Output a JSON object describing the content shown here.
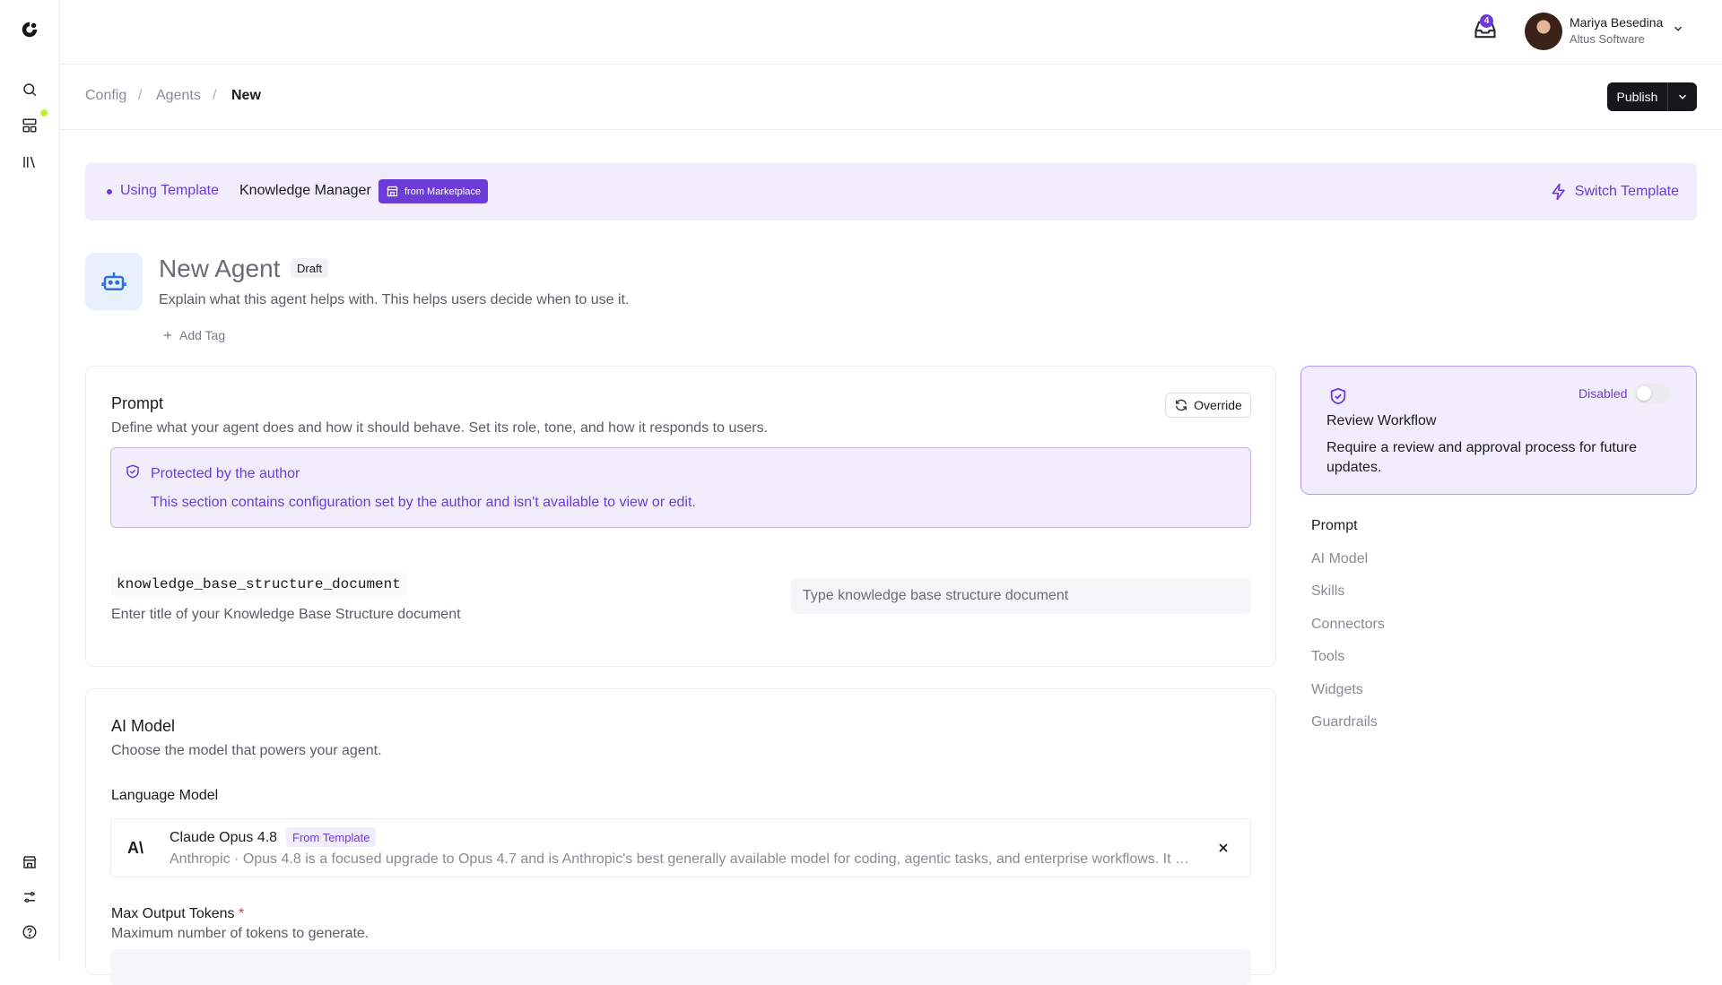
{
  "user": {
    "name": "Mariya Besedina",
    "org": "Altus Software",
    "notifications": "4"
  },
  "breadcrumb": {
    "items": [
      "Config",
      "Agents",
      "New"
    ],
    "separator": "/"
  },
  "actions": {
    "publish_label": "Publish"
  },
  "template": {
    "using_label": "Using Template",
    "name": "Knowledge Manager",
    "badge": "from Marketplace",
    "switch_label": "Switch Template"
  },
  "agent": {
    "title": "New Agent",
    "status": "Draft",
    "description": "Explain what this agent helps with. This helps users decide when to use it.",
    "add_tag_label": "Add Tag"
  },
  "prompt_section": {
    "title": "Prompt",
    "subtitle": "Define what your agent does and how it should behave. Set its role, tone, and how it responds to users.",
    "override_label": "Override",
    "protected_title": "Protected by the author",
    "protected_desc": "This section contains configuration set by the author and isn't available to view or edit.",
    "variable_name": "knowledge_base_structure_document",
    "variable_help": "Enter title of your Knowledge Base Structure document",
    "variable_placeholder": "Type knowledge base structure document",
    "variable_value": ""
  },
  "model_section": {
    "title": "AI Model",
    "subtitle": "Choose the model that powers your agent.",
    "language_model_label": "Language Model",
    "model_logo": "A\\",
    "model_name": "Claude Opus 4.8",
    "model_tag": "From Template",
    "model_desc": "Anthropic · Opus 4.8 is a focused upgrade to Opus 4.7 and is Anthropic's best generally available model for coding, agentic tasks, and enterprise workflows. It buil...",
    "max_tokens_label": "Max Output Tokens",
    "max_tokens_required": "*",
    "max_tokens_help": "Maximum number of tokens to generate."
  },
  "review_workflow": {
    "title": "Review Workflow",
    "description": "Require a review and approval process for future updates.",
    "status": "Disabled",
    "enabled": false
  },
  "toc": {
    "items": [
      "Prompt",
      "AI Model",
      "Skills",
      "Connectors",
      "Tools",
      "Widgets",
      "Guardrails"
    ],
    "active": "Prompt"
  },
  "colors": {
    "accent": "#6d3bd7",
    "accent_bg": "#f2edfc",
    "status_dot": "#b9f13a",
    "primary_button": "#17171b"
  },
  "icons": {
    "rail": [
      "logo-icon",
      "search-icon",
      "dashboard-icon",
      "library-icon",
      "marketplace-icon",
      "settings-icon",
      "help-icon"
    ],
    "misc": [
      "inbox-icon",
      "chevron-down-icon",
      "store-icon",
      "lightning-icon",
      "robot-icon",
      "plus-icon",
      "refresh-icon",
      "shield-icon",
      "close-icon"
    ]
  }
}
